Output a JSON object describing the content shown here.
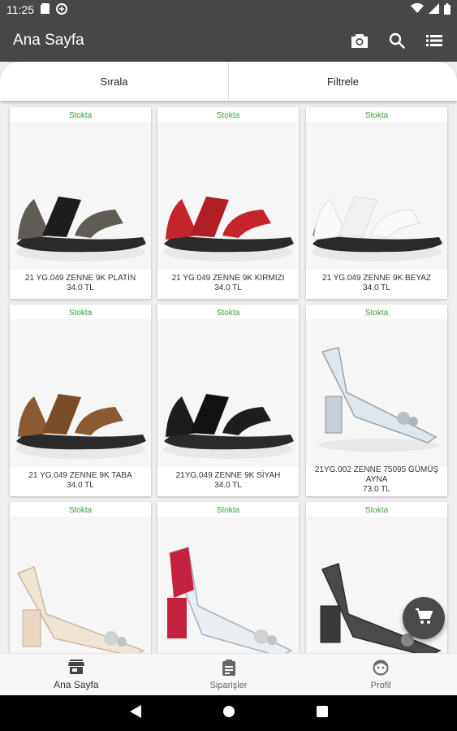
{
  "status_bar": {
    "time": "11:25"
  },
  "app_bar": {
    "title": "Ana Sayfa"
  },
  "tabs": [
    {
      "label": "Sırala"
    },
    {
      "label": "Filtrele"
    }
  ],
  "products": [
    {
      "stock": "Stokta",
      "name": "21 YG.049 ZENNE 9K PLATİN",
      "price": "34.0 TL",
      "color": "#5f5b55"
    },
    {
      "stock": "Stokta",
      "name": "21 YG.049 ZENNE 9K KIRMIZI",
      "price": "34.0 TL",
      "color": "#c4242b"
    },
    {
      "stock": "Stokta",
      "name": "21 YG.049 ZENNE 9K BEYAZ",
      "price": "34.0 TL",
      "color": "#f3f3f3"
    },
    {
      "stock": "Stokta",
      "name": "21 YG.049 ZENNE 9K TABA",
      "price": "34.0 TL",
      "color": "#8a5a32"
    },
    {
      "stock": "Stokta",
      "name": "21YG.049 ZENNE 9K SİYAH",
      "price": "34.0 TL",
      "color": "#1d1d1d"
    },
    {
      "stock": "Stokta",
      "name": "21YG.002 ZENNE 75095 GÜMÜŞ AYNA",
      "price": "73.0 TL",
      "color": "#c8cfd6"
    },
    {
      "stock": "Stokta",
      "name": "",
      "price": "",
      "color": "#e8d8c2"
    },
    {
      "stock": "Stokta",
      "name": "",
      "price": "",
      "color": "#c4213f"
    },
    {
      "stock": "Stokta",
      "name": "",
      "price": "",
      "color": "#3a3a3a"
    }
  ],
  "bottom_nav": [
    {
      "label": "Ana Sayfa"
    },
    {
      "label": "Siparişler"
    },
    {
      "label": "Profil"
    }
  ],
  "colors": {
    "app_bar": "#474747",
    "stock_green": "#35a13b",
    "fab": "#4a4a4a"
  }
}
